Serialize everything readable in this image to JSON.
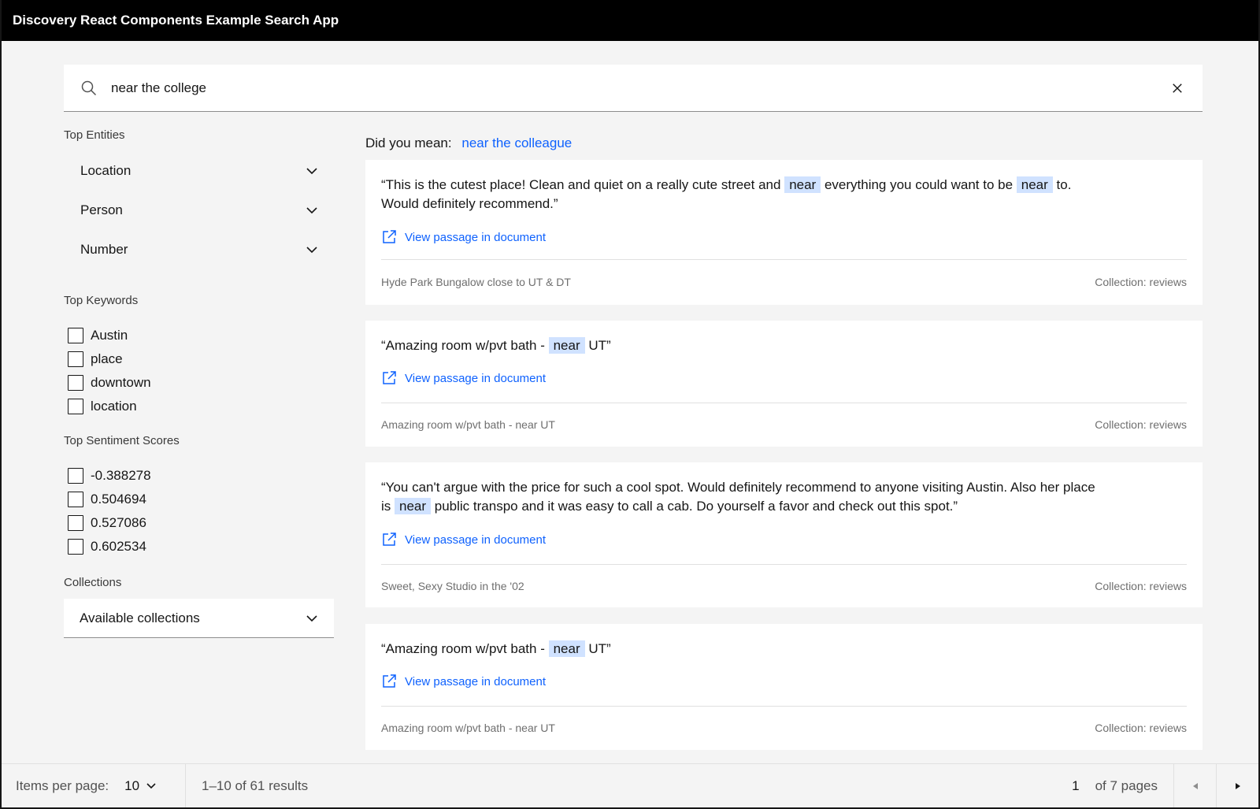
{
  "header": {
    "title": "Discovery React Components Example Search App"
  },
  "search": {
    "value": "near the college",
    "placeholder": ""
  },
  "sidebar": {
    "top_entities": {
      "title": "Top Entities",
      "items": [
        "Location",
        "Person",
        "Number"
      ]
    },
    "top_keywords": {
      "title": "Top Keywords",
      "items": [
        "Austin",
        "place",
        "downtown",
        "location"
      ]
    },
    "top_sentiment": {
      "title": "Top Sentiment Scores",
      "items": [
        "-0.388278",
        "0.504694",
        "0.527086",
        "0.602534"
      ]
    },
    "collections": {
      "title": "Collections",
      "select_label": "Available collections"
    }
  },
  "did_you_mean": {
    "label": "Did you mean:",
    "suggestion": "near the colleague"
  },
  "results": [
    {
      "passage_parts": [
        "“This is the cutest place! Clean and quiet on a really cute street and ",
        "near",
        " everything you could want to be ",
        "near",
        " to.",
        "Would definitely recommend.”"
      ],
      "link": "View passage in document",
      "title": "Hyde Park Bungalow close to UT & DT",
      "collection": "Collection: reviews"
    },
    {
      "passage_parts": [
        "“Amazing room w/pvt bath - ",
        "near",
        " UT”"
      ],
      "link": "View passage in document",
      "title": "Amazing room w/pvt bath - near UT",
      "collection": "Collection: reviews"
    },
    {
      "passage_parts": [
        "“You can't argue with the price for such a cool spot. Would definitely recommend to anyone visiting Austin. Also her place",
        "is ",
        "near",
        " public transpo and it was easy to call a cab. Do yourself a favor and check out this spot.”"
      ],
      "link": "View passage in document",
      "title": "Sweet, Sexy Studio in the '02",
      "collection": "Collection: reviews"
    },
    {
      "passage_parts": [
        "“Amazing room w/pvt bath - ",
        "near",
        " UT”"
      ],
      "link": "View passage in document",
      "title": "Amazing room w/pvt bath - near UT",
      "collection": "Collection: reviews"
    }
  ],
  "pagination": {
    "items_per_page_label": "Items per page:",
    "items_per_page": "10",
    "range": "1–10 of 61 results",
    "page": "1",
    "of_pages": "of 7 pages"
  },
  "colors": {
    "accent": "#0f62fe",
    "highlight": "#d0e2ff",
    "header_bg": "#000000"
  }
}
